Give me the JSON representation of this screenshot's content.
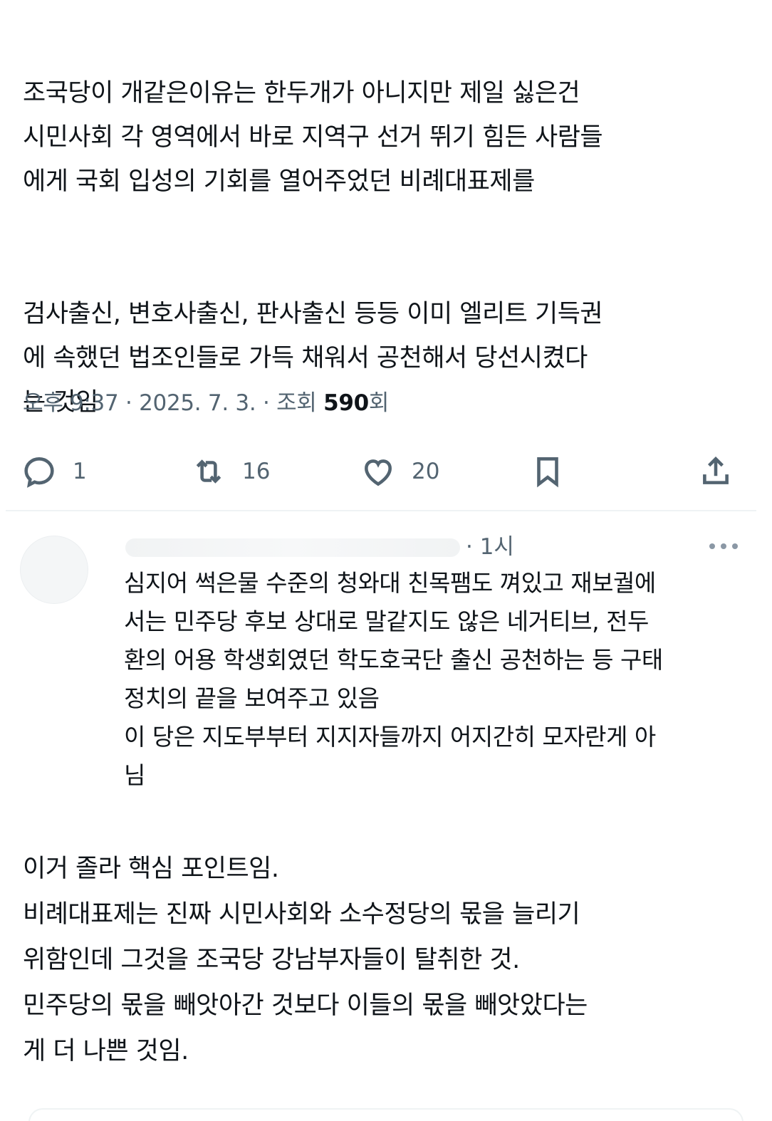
{
  "tweet": {
    "paragraphs": [
      "조국당이 개같은이유는 한두개가 아니지만 제일 싫은건\n시민사회 각 영역에서 바로 지역구 선거 뛰기 힘든 사람들\n에게 국회 입성의 기회를 열어주었던 비례대표제를",
      "검사출신, 변호사출신, 판사출신 등등 이미 엘리트 기득권\n에 속했던 법조인들로 가득 채워서 공천해서 당선시켰다\n는 것임"
    ],
    "meta": {
      "time": "오후 9:37",
      "date": "2025. 7. 3.",
      "views_prefix": "조회",
      "views_count": "590",
      "views_suffix": "회"
    },
    "actions": {
      "reply_count": "1",
      "retweet_count": "16",
      "like_count": "20"
    }
  },
  "reply": {
    "time": "· 1시",
    "text": "심지어 썩은물 수준의 청와대 친목팸도 껴있고 재보궐에\n서는 민주당 후보 상대로 말같지도 않은 네거티브, 전두\n환의 어용 학생회였던 학도호국단 출신 공천하는 등 구태\n정치의 끝을 보여주고 있음\n이 당은 지도부부터 지지자들까지 어지간히 모자란게 아\n님"
  },
  "comment": {
    "text": "이거 졸라 핵심 포인트임.\n비례대표제는 진짜 시민사회와 소수정당의 몫을 늘리기\n위함인데 그것을 조국당 강남부자들이 탈취한 것.\n민주당의 몫을 빼앗아간 것보다 이들의 몫을 빼앗았다는\n게 더 나쁜 것임."
  },
  "colors": {
    "text": "#0f1419",
    "secondary": "#536471",
    "divider": "#eff3f4"
  },
  "icons": [
    "reply-icon",
    "retweet-icon",
    "like-icon",
    "bookmark-icon",
    "share-icon",
    "more-icon"
  ]
}
